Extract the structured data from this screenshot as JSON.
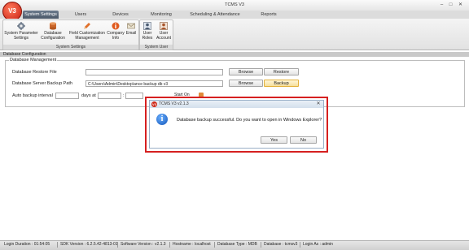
{
  "window": {
    "title": "TCMS V3",
    "logo_text": "V3",
    "minimize": "–",
    "maximize": "□",
    "close": "✕"
  },
  "menu": {
    "tabs": [
      "System Settings",
      "Users",
      "Devices",
      "Monitoring",
      "Scheduling & Attendance",
      "Reports"
    ],
    "active": "System Settings"
  },
  "ribbon": {
    "groups": [
      {
        "label": "System Settings",
        "buttons": [
          {
            "label": "System Parameter Settings",
            "icon": "gear-icon"
          },
          {
            "label": "Database Configuration",
            "icon": "database-icon"
          },
          {
            "label": "Field Customization Management",
            "icon": "pencil-icon"
          },
          {
            "label": "Company Info",
            "icon": "info-icon"
          },
          {
            "label": "Email",
            "icon": "email-icon"
          }
        ]
      },
      {
        "label": "System User",
        "buttons": [
          {
            "label": "User Roles",
            "icon": "user-roles-icon"
          },
          {
            "label": "User Account",
            "icon": "user-account-icon"
          }
        ]
      }
    ]
  },
  "main": {
    "section_title": "Database Configuration",
    "group_title": "Database Management",
    "restore": {
      "label": "Database Restore File",
      "value": "",
      "browse": "Browse",
      "action": "Restore"
    },
    "backup": {
      "label": "Database Server Backup Path",
      "value": "C:\\Users\\Admin\\Desktop\\ance backup db v3",
      "browse": "Browse",
      "action": "Backup"
    },
    "auto": {
      "label": "Auto backup interval",
      "days_value": "",
      "days_label": "days at",
      "time_value": "",
      "sep": ":",
      "start_on": "Start On"
    }
  },
  "dialog": {
    "title": "TCMS V3 v2.1.3",
    "message": "Database backup successful. Do you want to open in Windows Explorer?",
    "yes": "Yes",
    "no": "No",
    "close": "✕",
    "icon": "info-icon"
  },
  "statusbar": {
    "items": [
      "Login Duration : 01:54:05",
      "SDK Version : 6.2.5.42-4813-01",
      "Software Version : v2.1.3",
      "Hostname : localhost",
      "Database Type : MDB",
      "Database : tcmsv3",
      "Login As : admin"
    ]
  },
  "colors": {
    "highlight": "#d62020",
    "active_tab": "#4b5868",
    "focus_button": "#f6df9c"
  }
}
